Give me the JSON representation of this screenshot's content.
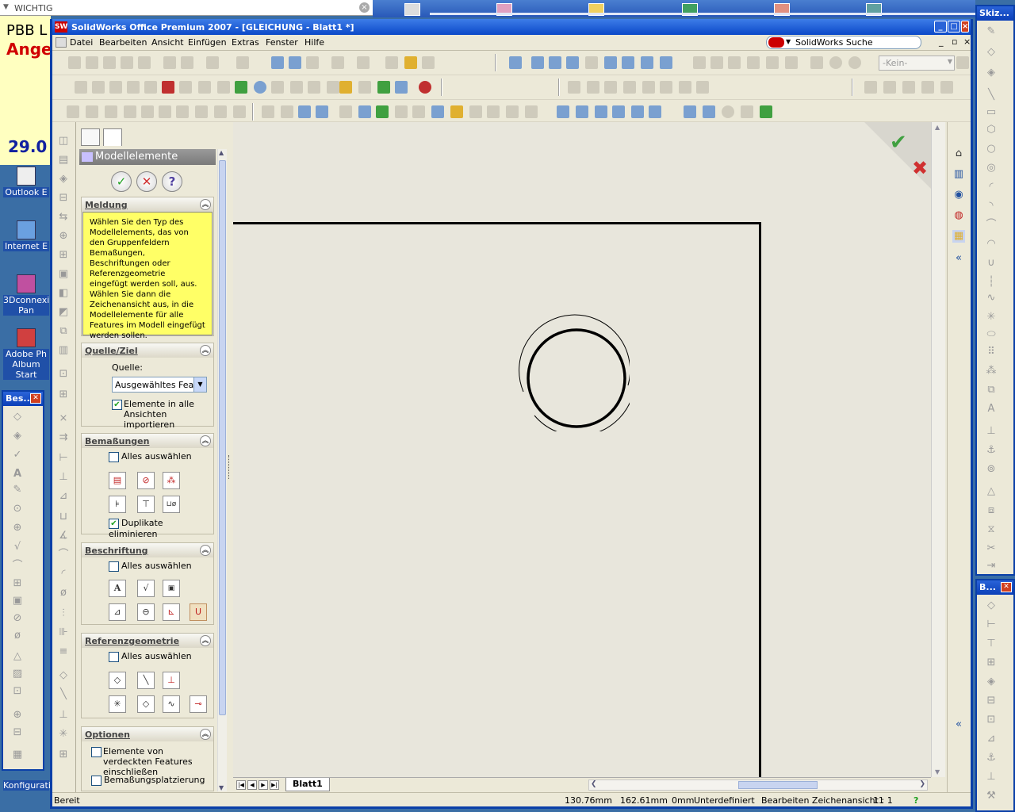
{
  "desktop": {
    "topbar_label": "WICHTIG",
    "yellow_line1": "PBB L",
    "yellow_line2": "Ange",
    "yellow_date": "29.0",
    "icons": [
      {
        "label": "Outlook E"
      },
      {
        "label": "Internet E"
      },
      {
        "label": "3Dconnexio Pan"
      },
      {
        "label": "Adobe Ph Album Start"
      },
      {
        "label": "Konfiguratio"
      }
    ],
    "left_floating_title": "Bes...",
    "skiz_title": "Skiz...",
    "b_title": "B..."
  },
  "window": {
    "title": "SolidWorks Office Premium 2007 - [GLEICHUNG - Blatt1 *]",
    "logo": "SW"
  },
  "menu": {
    "items": [
      "Datei",
      "Bearbeiten",
      "Ansicht",
      "Einfügen",
      "Extras",
      "Fenster",
      "Hilfe"
    ],
    "search_label": "SolidWorks Suche"
  },
  "toolbar": {
    "layer_dropdown": "-Kein-"
  },
  "property_manager": {
    "title": "Modellelemente",
    "buttons": {
      "ok": "✓",
      "cancel": "✕",
      "help": "?"
    },
    "meldung": {
      "heading": "Meldung",
      "text": "Wählen Sie den Typ des Modellelements, das von den Gruppenfeldern Bemaßungen, Beschriftungen oder Referenzgeometrie eingefügt werden soll, aus. Wählen Sie dann die Zeichenansicht aus, in die Modellelemente für alle Features im Modell eingefügt werden sollen."
    },
    "quelle_ziel": {
      "heading": "Quelle/Ziel",
      "source_label": "Quelle:",
      "source_value": "Ausgewähltes Featu",
      "import_all_label": "Elemente in alle Ansichten importieren",
      "import_all_checked": true
    },
    "bemassungen": {
      "heading": "Bemaßungen",
      "select_all": "Alles auswählen",
      "eliminate_duplicates": "Duplikate eliminieren",
      "eliminate_duplicates_checked": true
    },
    "beschriftung": {
      "heading": "Beschriftung",
      "select_all": "Alles auswählen"
    },
    "referenzgeometrie": {
      "heading": "Referenzgeometrie",
      "select_all": "Alles auswählen"
    },
    "optionen": {
      "heading": "Optionen",
      "hidden_features": "Elemente von verdeckten Features einschließen",
      "dimension_placement": "Bemaßungsplatzierung"
    }
  },
  "sheet_tabs": {
    "active": "Blatt1"
  },
  "status": {
    "ready": "Bereit",
    "x": "130.76mm",
    "y": "162.61mm",
    "z": "0mm",
    "state": "Unterdefiniert",
    "mode": "Bearbeiten Zeichenansicht1",
    "scale": "1 : 1",
    "help": "?"
  },
  "colors": {
    "title_blue": "#0b48c8",
    "confirm_green": "#40a040",
    "cancel_red": "#d03030",
    "message_yellow": "#ffff66"
  }
}
